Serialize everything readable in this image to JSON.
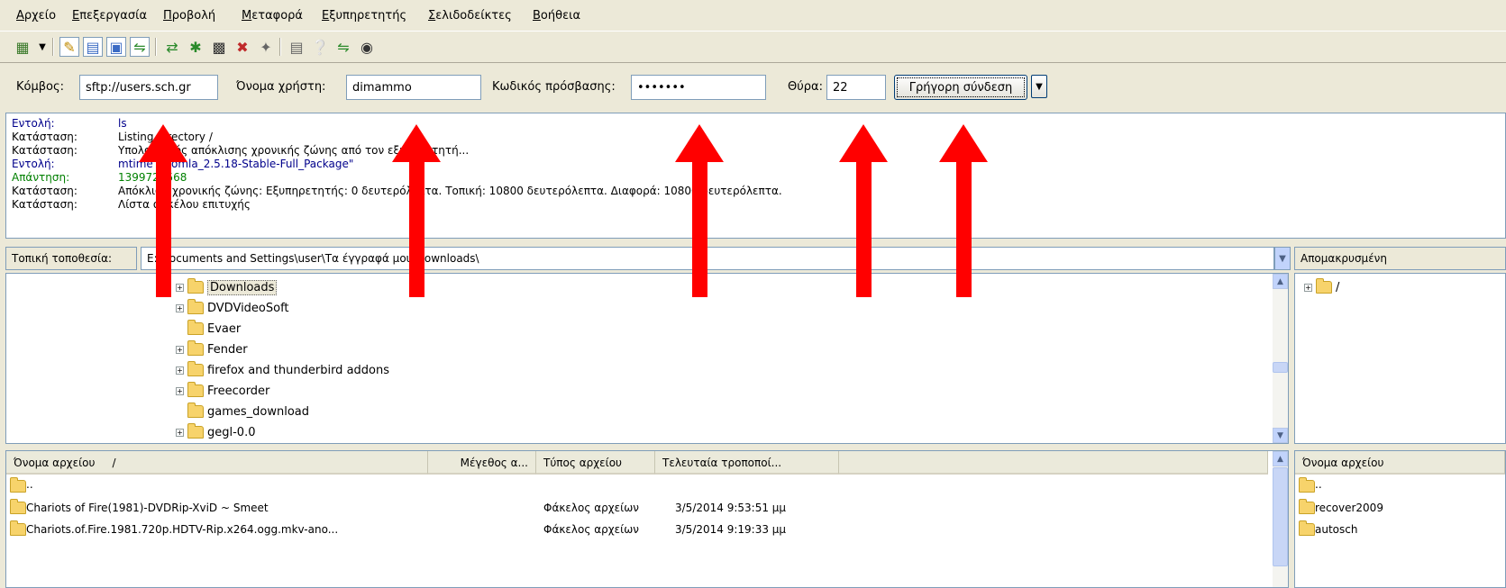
{
  "menu": [
    "Αρχείο",
    "Επεξεργασία",
    "Προβολή",
    "Μεταφορά",
    "Εξυπηρετητής",
    "Σελιδοδείκτες",
    "Βοήθεια"
  ],
  "quickconnect": {
    "host_label": "Κόμβος:",
    "host_value": "sftp://users.sch.gr",
    "user_label": "Όνομα χρήστη:",
    "user_value": "dimammo",
    "pass_label": "Κωδικός πρόσβασης:",
    "pass_value": "•••••••",
    "port_label": "Θύρα:",
    "port_value": "22",
    "button_label": "Γρήγορη σύνδεση"
  },
  "log": [
    {
      "label": "Εντολή:",
      "text": "ls",
      "color": "#00008b"
    },
    {
      "label": "Κατάσταση:",
      "text": "Listing directory /",
      "color": "#000000"
    },
    {
      "label": "Κατάσταση:",
      "text": "Υπολογισμός απόκλισης χρονικής ζώνης από τον εξυπηρετητή...",
      "color": "#000000"
    },
    {
      "label": "Εντολή:",
      "text": "mtime \"Joomla_2.5.18-Stable-Full_Package\"",
      "color": "#00008b"
    },
    {
      "label": "Απάντηση:",
      "text": "1399728568",
      "color": "#008000"
    },
    {
      "label": "Κατάσταση:",
      "text": "Απόκλιση χρονικής ζώνης: Εξυπηρετητής: 0 δευτερόλεπτα. Τοπική: 10800 δευτερόλεπτα. Διαφορά: 10800 δευτερόλεπτα.",
      "color": "#000000"
    },
    {
      "label": "Κατάσταση:",
      "text": "Λίστα φακέλου επιτυχής",
      "color": "#000000"
    }
  ],
  "local": {
    "label": "Τοπική τοποθεσία:",
    "path": "E:\\Documents and Settings\\user\\Τα έγγραφά μου\\Downloads\\",
    "tree": [
      {
        "name": "Downloads",
        "expandable": true,
        "selected": true
      },
      {
        "name": "DVDVideoSoft",
        "expandable": true,
        "selected": false
      },
      {
        "name": "Evaer",
        "expandable": false,
        "selected": false
      },
      {
        "name": "Fender",
        "expandable": true,
        "selected": false
      },
      {
        "name": "firefox and thunderbird addons",
        "expandable": true,
        "selected": false
      },
      {
        "name": "Freecorder",
        "expandable": true,
        "selected": false
      },
      {
        "name": "games_download",
        "expandable": false,
        "selected": false
      },
      {
        "name": "gegl-0.0",
        "expandable": true,
        "selected": false
      }
    ],
    "columns": [
      "Όνομα αρχείου",
      "Μέγεθος α...",
      "Τύπος αρχείου",
      "Τελευταία τροποποί..."
    ],
    "sort_glyph": "/",
    "files": [
      {
        "name": "..",
        "size": "",
        "type": "",
        "modified": ""
      },
      {
        "name": "Chariots of Fire(1981)-DVDRip-XviD ~ Smeet",
        "size": "",
        "type": "Φάκελος αρχείων",
        "modified": "3/5/2014 9:53:51 μμ"
      },
      {
        "name": "Chariots.of.Fire.1981.720p.HDTV-Rip.x264.ogg.mkv-ano...",
        "size": "",
        "type": "Φάκελος αρχείων",
        "modified": "3/5/2014 9:19:33 μμ"
      }
    ]
  },
  "remote": {
    "label": "Απομακρυσμένη",
    "tree_root": "/",
    "column": "Όνομα αρχείου",
    "files": [
      "..",
      "recover2009",
      "autosch"
    ]
  },
  "colors": {
    "arrow": "#ff0000",
    "selection": "#ece9d8"
  }
}
